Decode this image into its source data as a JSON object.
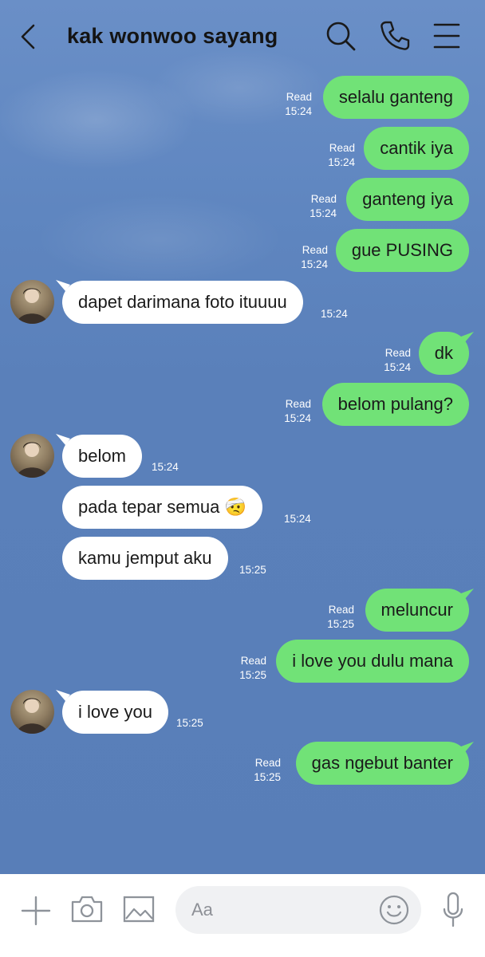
{
  "header": {
    "title": "kak wonwoo sayang",
    "icons": [
      "back-arrow-icon",
      "search-icon",
      "phone-icon",
      "menu-icon"
    ]
  },
  "messages": [
    {
      "side": "out",
      "text": "selalu ganteng",
      "read": "Read",
      "time": "15:24"
    },
    {
      "side": "out",
      "text": "cantik iya",
      "read": "Read",
      "time": "15:24"
    },
    {
      "side": "out",
      "text": "ganteng iya",
      "read": "Read",
      "time": "15:24"
    },
    {
      "side": "out",
      "text": "gue PUSING",
      "read": "Read",
      "time": "15:24"
    },
    {
      "side": "in",
      "text": "dapet darimana foto ituuuu",
      "time": "15:24"
    },
    {
      "side": "out",
      "text": "dk",
      "read": "Read",
      "time": "15:24"
    },
    {
      "side": "out",
      "text": "belom pulang?",
      "read": "Read",
      "time": "15:24"
    },
    {
      "side": "in",
      "text": "belom",
      "time": "15:24"
    },
    {
      "side": "in",
      "text": "pada tepar semua 🤕",
      "time": "15:24"
    },
    {
      "side": "in",
      "text": "kamu jemput aku",
      "time": "15:25"
    },
    {
      "side": "out",
      "text": "meluncur",
      "read": "Read",
      "time": "15:25"
    },
    {
      "side": "out",
      "text": "i love you dulu mana",
      "read": "Read",
      "time": "15:25"
    },
    {
      "side": "in",
      "text": "i love you",
      "time": "15:25"
    },
    {
      "side": "out",
      "text": "gas ngebut banter",
      "read": "Read",
      "time": "15:25"
    }
  ],
  "input": {
    "placeholder": "Aa",
    "icons": [
      "plus-icon",
      "camera-icon",
      "image-icon",
      "emoji-icon",
      "microphone-icon"
    ]
  },
  "colors": {
    "background": "#5a80ba",
    "outgoing_bubble": "#71e277",
    "incoming_bubble": "#ffffff"
  }
}
